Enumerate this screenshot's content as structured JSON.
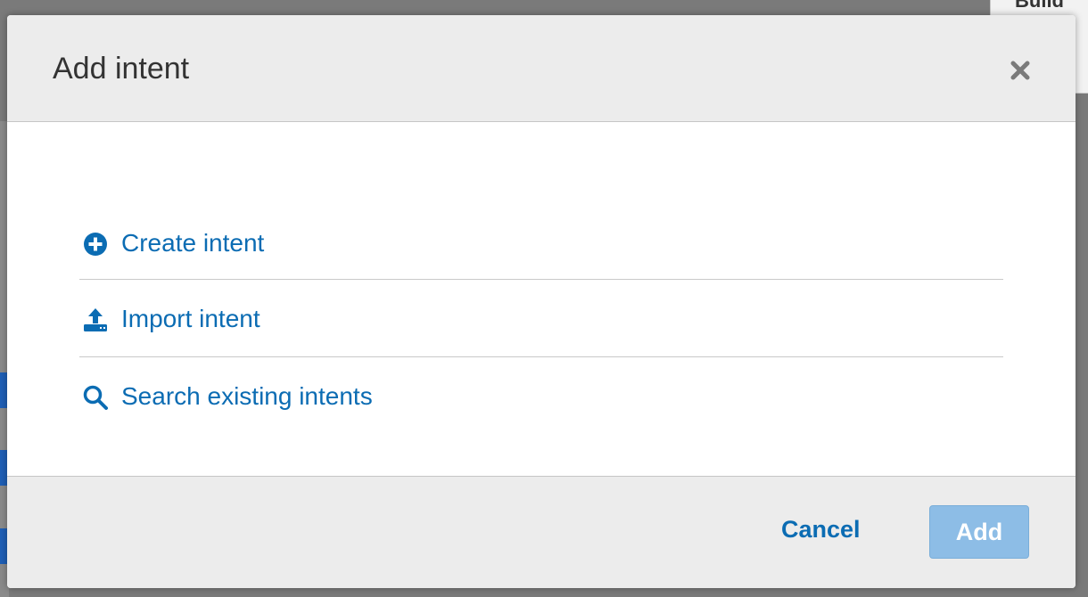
{
  "background": {
    "tab_label": "Build"
  },
  "dialog": {
    "title": "Add intent",
    "close_icon": "close-icon",
    "options": [
      {
        "label": "Create intent",
        "icon": "plus-circle-icon"
      },
      {
        "label": "Import intent",
        "icon": "upload-icon"
      },
      {
        "label": "Search existing intents",
        "icon": "search-icon"
      }
    ],
    "footer": {
      "cancel_label": "Cancel",
      "add_label": "Add"
    }
  },
  "colors": {
    "link": "#0b6cb3",
    "add_button_disabled": "#8dbde6",
    "header_bg": "#ececec"
  }
}
